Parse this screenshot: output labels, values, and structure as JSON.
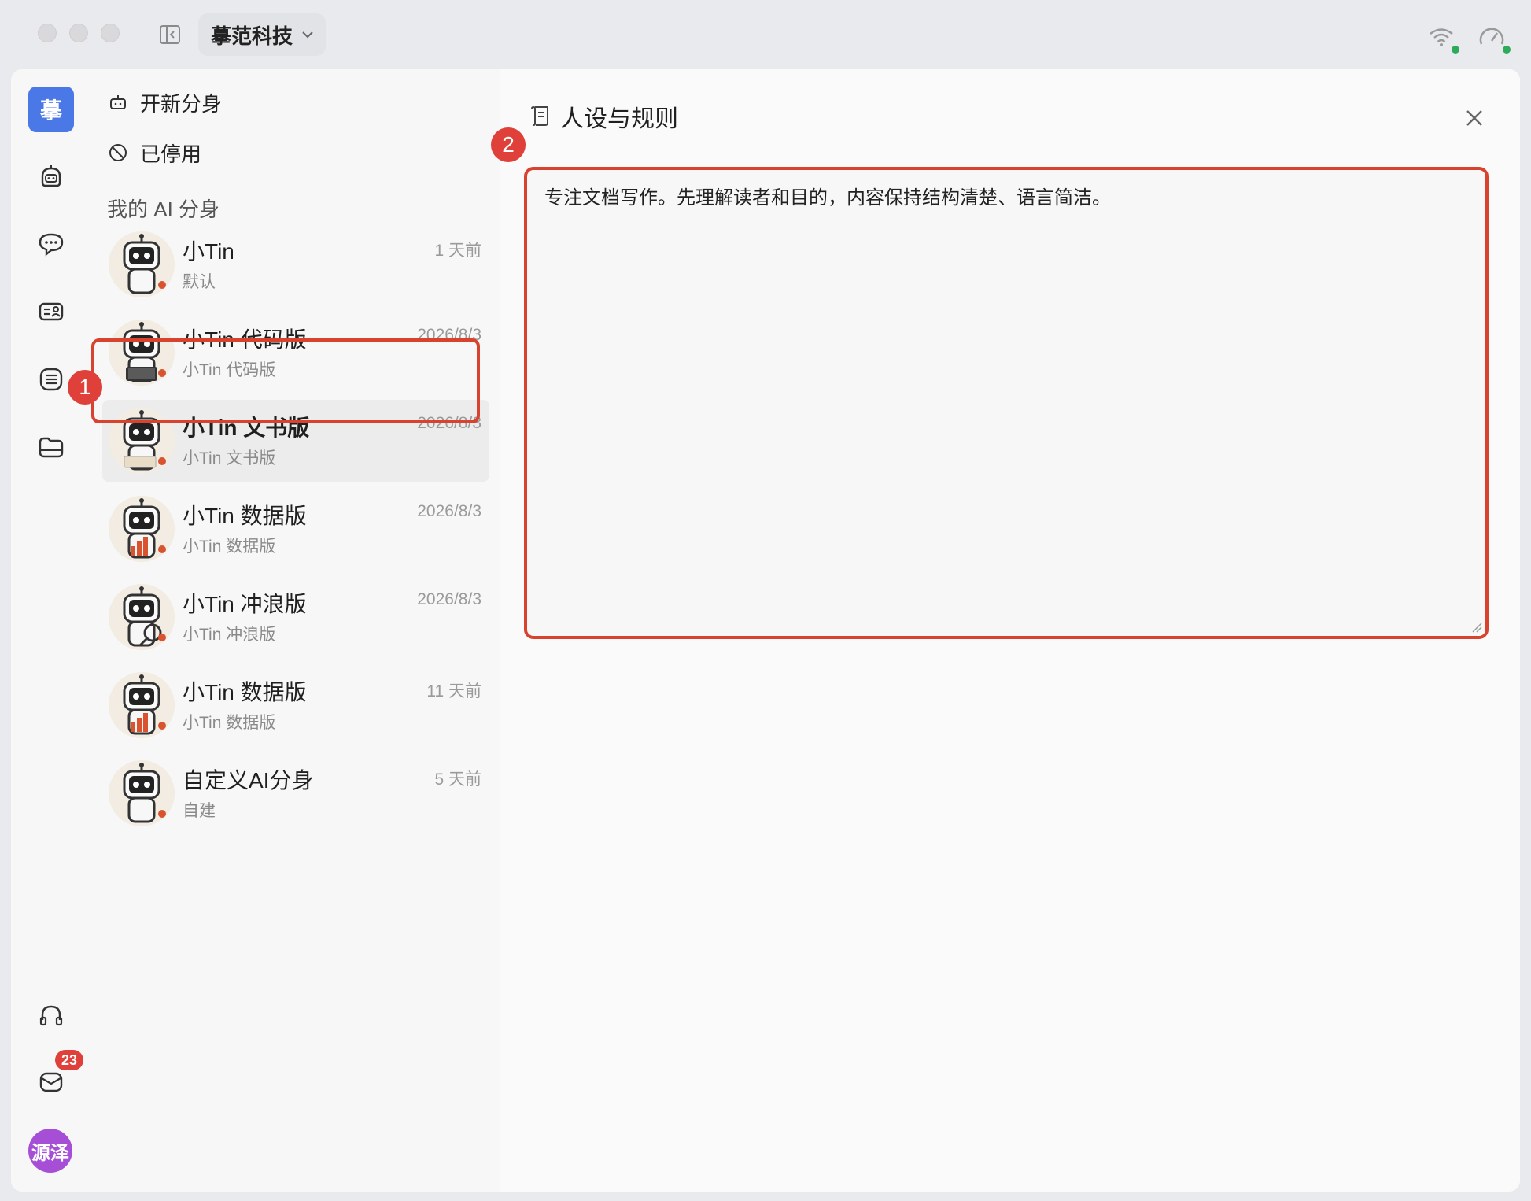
{
  "titlebar": {
    "org_name": "摹范科技"
  },
  "rail": {
    "logo_text": "摹",
    "mail_badge": "23",
    "user_avatar_text": "源泽"
  },
  "markers": {
    "one": "1",
    "two": "2"
  },
  "list": {
    "new_clone_label": "开新分身",
    "disabled_label": "已停用",
    "section_title": "我的 AI 分身",
    "agents": [
      {
        "name": "小Tin",
        "sub": "默认",
        "time": "1 天前"
      },
      {
        "name": "小Tin 代码版",
        "sub": "小Tin 代码版",
        "time": "2026/8/3"
      },
      {
        "name": "小Tin 文书版",
        "sub": "小Tin 文书版",
        "time": "2026/8/3"
      },
      {
        "name": "小Tin 数据版",
        "sub": "小Tin 数据版",
        "time": "2026/8/3"
      },
      {
        "name": "小Tin 冲浪版",
        "sub": "小Tin 冲浪版",
        "time": "2026/8/3"
      },
      {
        "name": "小Tin 数据版",
        "sub": "小Tin 数据版",
        "time": "11 天前"
      },
      {
        "name": "自定义AI分身",
        "sub": "自建",
        "time": "5 天前"
      }
    ]
  },
  "detail": {
    "title": "人设与规则",
    "persona_text": "专注文档写作。先理解读者和目的，内容保持结构清楚、语言简洁。"
  },
  "colors": {
    "accent": "#4a78e6",
    "highlight": "#d8432f",
    "badge": "#e0403a",
    "user_avatar": "#a64fd6",
    "online": "#2daa5a"
  }
}
